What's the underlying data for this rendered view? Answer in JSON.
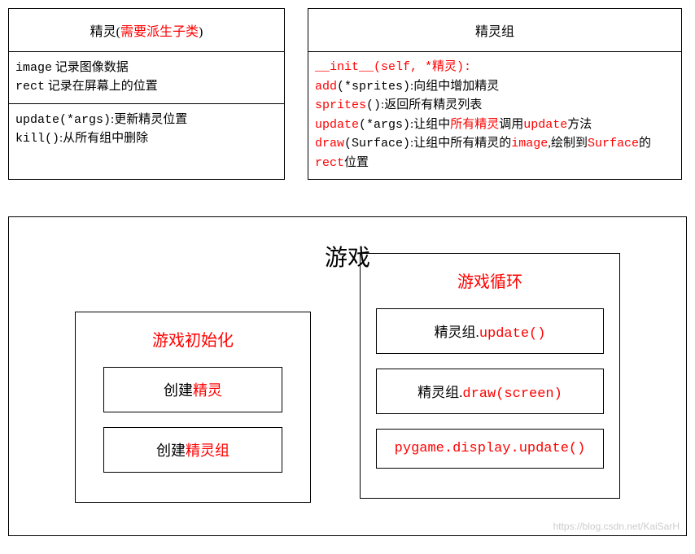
{
  "sprite_box": {
    "title_prefix": "精灵(",
    "title_highlight": "需要派生子类",
    "title_suffix": ")",
    "attrs": {
      "line1_code": "image",
      "line1_text": " 记录图像数据",
      "line2_code": "rect",
      "line2_text": " 记录在屏幕上的位置"
    },
    "methods": {
      "line1_code": "update(*args)",
      "line1_text": ":更新精灵位置",
      "line2_code": "kill()",
      "line2_text": ":从所有组中删除"
    }
  },
  "group_box": {
    "title": "精灵组",
    "init_line": "__init__(self, *精灵):",
    "add_code": "add",
    "add_args": "(*sprites)",
    "add_text": ":向组中增加精灵",
    "sprites_code": "sprites",
    "sprites_args": "()",
    "sprites_text": ":返回所有精灵列表",
    "update_code": "update",
    "update_args": "(*args)",
    "update_text1": ":让组中",
    "update_hl1": "所有精灵",
    "update_text2": "调用",
    "update_hl2": "update",
    "update_text3": "方法",
    "draw_code": "draw",
    "draw_args": "(Surface)",
    "draw_text1": ":让组中所有精灵的",
    "draw_hl1": "image",
    "draw_text2": ",绘制到",
    "draw_hl2": "Surface",
    "draw_text3": "的",
    "draw_hl3": "rect",
    "draw_text4": "位置"
  },
  "game": {
    "title": "游戏",
    "init": {
      "title": "游戏初始化",
      "item1_prefix": "创建",
      "item1_hl": "精灵",
      "item2_prefix": "创建",
      "item2_hl": "精灵组"
    },
    "loop": {
      "title": "游戏循环",
      "item1_black": "精灵组.",
      "item1_red": "update()",
      "item2_black": "精灵组.",
      "item2_red": "draw(screen)",
      "item3": "pygame.display.update()"
    }
  },
  "watermark": "https://blog.csdn.net/KaiSarH"
}
